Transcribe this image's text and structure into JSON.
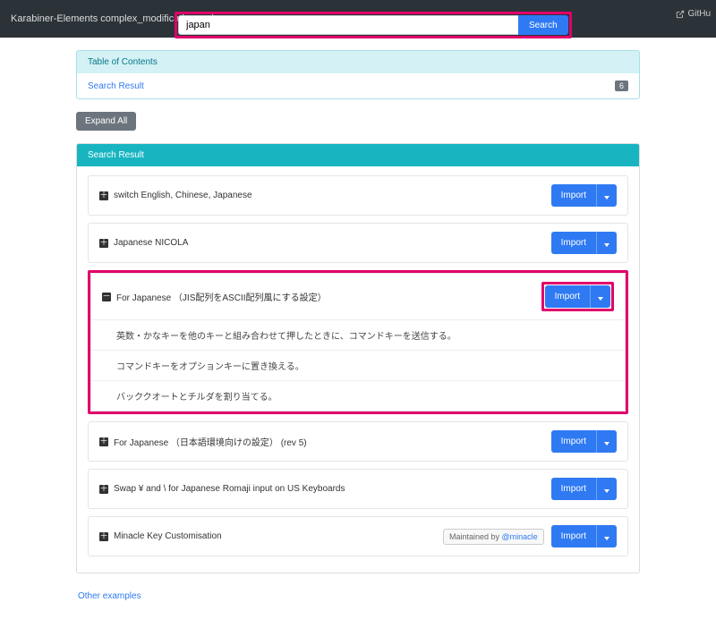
{
  "navbar": {
    "title": "Karabiner-Elements complex_modifications rules",
    "gh_label": "GitHu"
  },
  "search": {
    "value": "japan",
    "placeholder": "",
    "button": "Search"
  },
  "toc": {
    "heading": "Table of Contents",
    "search_result_link": "Search Result",
    "count": "6"
  },
  "buttons": {
    "expand_all": "Expand All",
    "import": "Import"
  },
  "panel": {
    "heading": "Search Result"
  },
  "rules": {
    "r0": {
      "title": "switch English, Chinese, Japanese"
    },
    "r1": {
      "title": "Japanese NICOLA"
    },
    "r2": {
      "title": "For Japanese （JIS配列をASCII配列風にする設定）",
      "sub0": "英数・かなキーを他のキーと組み合わせて押したときに、コマンドキーを送信する。",
      "sub1": "コマンドキーをオプションキーに置き換える。",
      "sub2": "バッククオートとチルダを割り当てる。"
    },
    "r3": {
      "title": "For Japanese （日本語環境向けの設定） (rev 5)"
    },
    "r4": {
      "title": "Swap ¥ and \\ for Japanese Romaji input on US Keyboards"
    },
    "r5": {
      "title": "Minacle Key Customisation",
      "maintained_prefix": "Maintained by ",
      "maintained_link": "@minacle"
    }
  },
  "footer": {
    "other_examples": "Other examples"
  }
}
